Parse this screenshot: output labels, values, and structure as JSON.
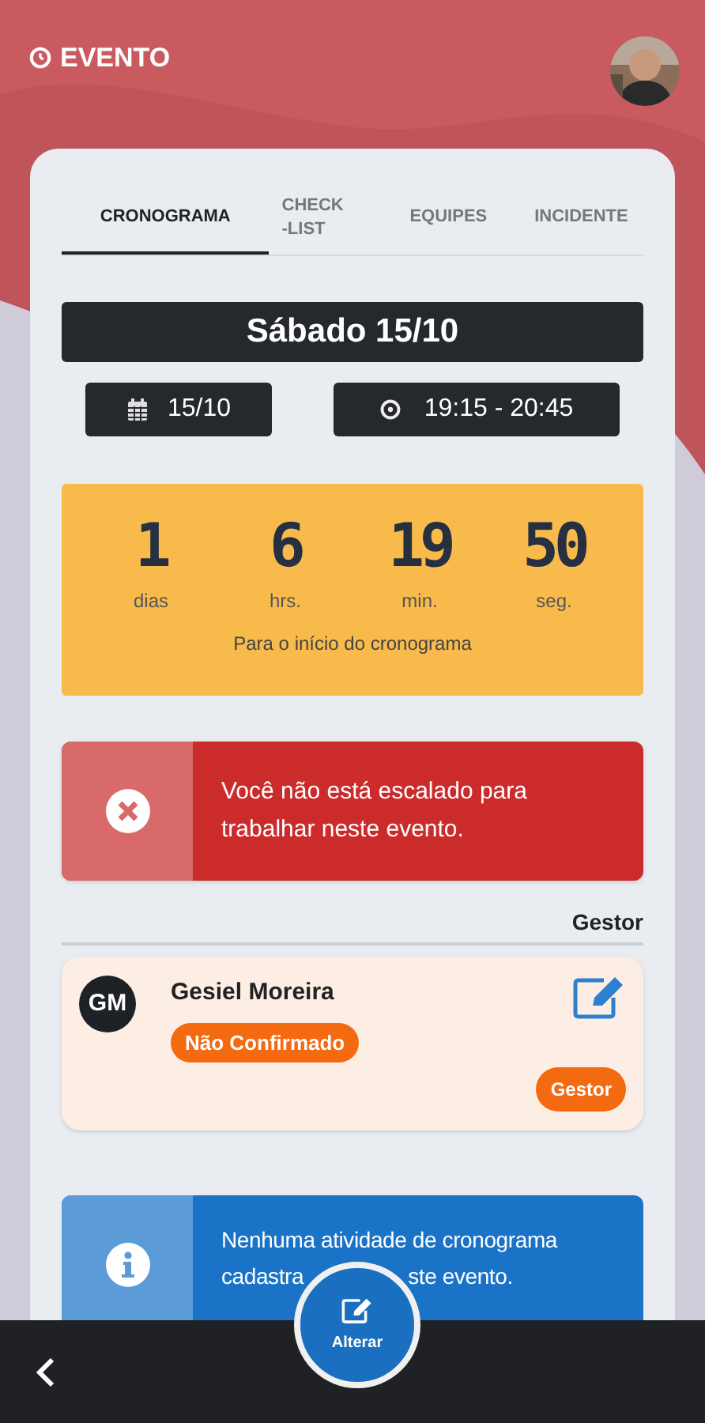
{
  "header": {
    "title": "EVENTO"
  },
  "tabs": [
    {
      "label": "CRONOGRAMA",
      "selected": true
    },
    {
      "label": "CHECK-LIST",
      "selected": false
    },
    {
      "label": "EQUIPES",
      "selected": false
    },
    {
      "label": "INCIDENTE",
      "selected": false
    }
  ],
  "day_banner": "Sábado 15/10",
  "date": "15/10",
  "time": "19:15 - 20:45",
  "countdown": {
    "units": [
      {
        "value": "1",
        "label": "dias"
      },
      {
        "value": "6",
        "label": "hrs."
      },
      {
        "value": "19",
        "label": "min."
      },
      {
        "value": "50",
        "label": "seg."
      }
    ],
    "caption": "Para o início do cronograma"
  },
  "error_alert": {
    "message": "Você não está escalado para trabalhar neste evento."
  },
  "team": {
    "section_label": "Gestor",
    "members": [
      {
        "initials": "GM",
        "name": "Gesiel Moreira",
        "status": "Não Confirmado",
        "role": "Gestor"
      }
    ]
  },
  "info_alert": {
    "visible_parts": [
      "Nenhuma atividade de cronograma",
      "cadastra",
      "ste evento."
    ]
  },
  "fab": {
    "label": "Alterar"
  }
}
